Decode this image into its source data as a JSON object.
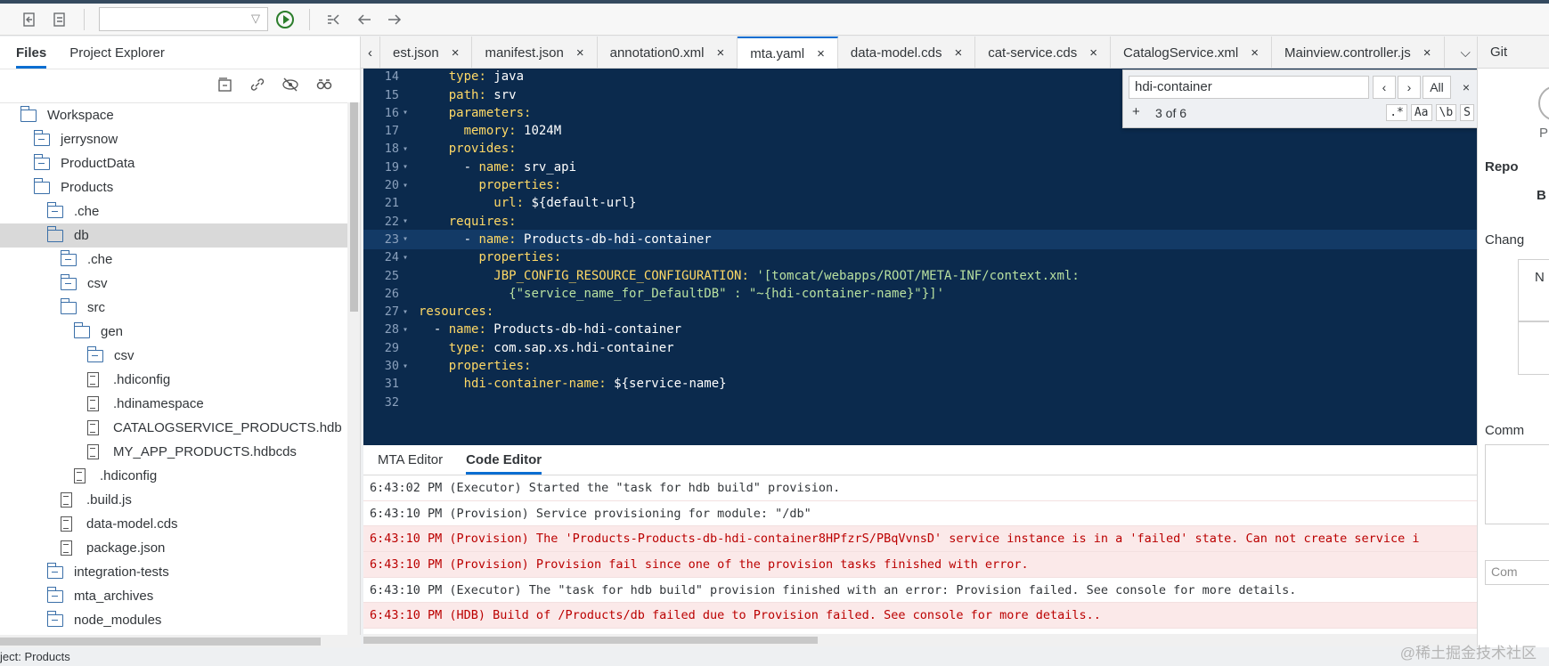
{
  "toolbar": {
    "run_config_value": "",
    "icons": [
      "undo-icon",
      "redo-icon",
      "run-icon",
      "build-icon",
      "back-icon",
      "forward-icon"
    ]
  },
  "left_panel": {
    "tabs": [
      {
        "label": "Files",
        "active": true
      },
      {
        "label": "Project Explorer",
        "active": false
      }
    ],
    "actions": [
      "collapse-all-icon",
      "link-editor-icon",
      "hide-hidden-icon",
      "search-files-icon"
    ],
    "tree": [
      {
        "label": "Workspace",
        "type": "folder-open",
        "level": 1
      },
      {
        "label": "jerrysnow",
        "type": "folder",
        "level": 2
      },
      {
        "label": "ProductData",
        "type": "folder",
        "level": 2
      },
      {
        "label": "Products",
        "type": "folder-open",
        "level": 2
      },
      {
        "label": ".che",
        "type": "folder",
        "level": 3
      },
      {
        "label": "db",
        "type": "folder-open",
        "level": 3,
        "selected": true
      },
      {
        "label": ".che",
        "type": "folder",
        "level": 4
      },
      {
        "label": "csv",
        "type": "folder",
        "level": 4
      },
      {
        "label": "src",
        "type": "folder-open",
        "level": 4
      },
      {
        "label": "gen",
        "type": "folder-open",
        "level": 5
      },
      {
        "label": "csv",
        "type": "folder",
        "level": 6
      },
      {
        "label": ".hdiconfig",
        "type": "file",
        "level": 6
      },
      {
        "label": ".hdinamespace",
        "type": "file",
        "level": 6
      },
      {
        "label": "CATALOGSERVICE_PRODUCTS.hdb",
        "type": "file",
        "level": 6
      },
      {
        "label": "MY_APP_PRODUCTS.hdbcds",
        "type": "file",
        "level": 6
      },
      {
        "label": ".hdiconfig",
        "type": "file",
        "level": 5
      },
      {
        "label": ".build.js",
        "type": "file",
        "level": 4
      },
      {
        "label": "data-model.cds",
        "type": "file",
        "level": 4
      },
      {
        "label": "package.json",
        "type": "file",
        "level": 4
      },
      {
        "label": "integration-tests",
        "type": "folder",
        "level": 3
      },
      {
        "label": "mta_archives",
        "type": "folder",
        "level": 3
      },
      {
        "label": "node_modules",
        "type": "folder",
        "level": 3
      }
    ]
  },
  "editor_tabs": [
    {
      "label": "est.json",
      "active": false
    },
    {
      "label": "manifest.json",
      "active": false
    },
    {
      "label": "annotation0.xml",
      "active": false
    },
    {
      "label": "mta.yaml",
      "active": true
    },
    {
      "label": "data-model.cds",
      "active": false
    },
    {
      "label": "cat-service.cds",
      "active": false
    },
    {
      "label": "CatalogService.xml",
      "active": false
    },
    {
      "label": "Mainview.controller.js",
      "active": false
    }
  ],
  "find": {
    "query": "hdi-container",
    "count": "3 of 6",
    "scope": "All",
    "options": [
      ".*",
      "Aa",
      "\\b",
      "S"
    ]
  },
  "code": [
    {
      "n": "14",
      "fold": "",
      "indent": "    ",
      "key": "type",
      "val": " java"
    },
    {
      "n": "15",
      "fold": "",
      "indent": "    ",
      "key": "path",
      "val": " srv"
    },
    {
      "n": "16",
      "fold": "▾",
      "indent": "    ",
      "key": "parameters",
      "val": ""
    },
    {
      "n": "17",
      "fold": "",
      "indent": "      ",
      "key": "memory",
      "val": " 1024M"
    },
    {
      "n": "18",
      "fold": "▾",
      "indent": "    ",
      "key": "provides",
      "val": ""
    },
    {
      "n": "19",
      "fold": "▾",
      "indent": "      - ",
      "key": "name",
      "val": " srv_api"
    },
    {
      "n": "20",
      "fold": "▾",
      "indent": "        ",
      "key": "properties",
      "val": ""
    },
    {
      "n": "21",
      "fold": "",
      "indent": "          ",
      "key": "url",
      "val": " ${default-url}"
    },
    {
      "n": "22",
      "fold": "▾",
      "indent": "    ",
      "key": "requires",
      "val": ""
    },
    {
      "n": "23",
      "fold": "▾",
      "indent": "      - ",
      "key": "name",
      "val": " Products-db-hdi-container",
      "hl": true
    },
    {
      "n": "24",
      "fold": "▾",
      "indent": "        ",
      "key": "properties",
      "val": ""
    },
    {
      "n": "25",
      "fold": "",
      "indent": "          ",
      "key": "JBP_CONFIG_RESOURCE_CONFIGURATION",
      "val": " '[tomcat/webapps/ROOT/META-INF/context.xml:",
      "str": true
    },
    {
      "n": "26",
      "fold": "",
      "indent": "            ",
      "key": "",
      "val": "{\"service_name_for_DefaultDB\" : \"~{hdi-container-name}\"}]'",
      "str": true
    },
    {
      "n": "27",
      "fold": "▾",
      "indent": "",
      "key": "resources",
      "val": ""
    },
    {
      "n": "28",
      "fold": "▾",
      "indent": "  - ",
      "key": "name",
      "val": " Products-db-hdi-container"
    },
    {
      "n": "29",
      "fold": "",
      "indent": "    ",
      "key": "type",
      "val": " com.sap.xs.hdi-container"
    },
    {
      "n": "30",
      "fold": "▾",
      "indent": "    ",
      "key": "properties",
      "val": ""
    },
    {
      "n": "31",
      "fold": "",
      "indent": "      ",
      "key": "hdi-container-name",
      "val": " ${service-name}"
    },
    {
      "n": "32",
      "fold": "",
      "indent": "",
      "key": "",
      "val": ""
    }
  ],
  "bottom_tabs": [
    {
      "label": "MTA Editor",
      "active": false
    },
    {
      "label": "Code Editor",
      "active": true
    }
  ],
  "console": [
    {
      "type": "info",
      "text": "6:43:02 PM (Executor) Started the \"task for hdb build\" provision."
    },
    {
      "type": "info",
      "text": "6:43:10 PM (Provision) Service provisioning for module: \"/db\""
    },
    {
      "type": "err",
      "text": "6:43:10 PM (Provision) The 'Products-Products-db-hdi-container8HPfzrS/PBqVvnsD' service instance is in a 'failed' state. Can not create service i"
    },
    {
      "type": "err",
      "text": "6:43:10 PM (Provision) Provision fail since one of the provision tasks finished with error."
    },
    {
      "type": "info",
      "text": "6:43:10 PM (Executor) The \"task for hdb build\" provision finished with an error: Provision failed. See console for more details."
    },
    {
      "type": "err",
      "text": "6:43:10 PM (HDB) Build of /Products/db failed due to Provision failed. See console for more details.."
    }
  ],
  "right_panel": {
    "tab": "Git",
    "p_label": "P",
    "repo_label": "Repo",
    "b_label": "B",
    "changes_label": "Chang",
    "n_label": "N",
    "commit_label": "Comm",
    "commit_input": "Com"
  },
  "status": {
    "project": "ject:  Products"
  },
  "watermark": "@稀土掘金技术社区"
}
